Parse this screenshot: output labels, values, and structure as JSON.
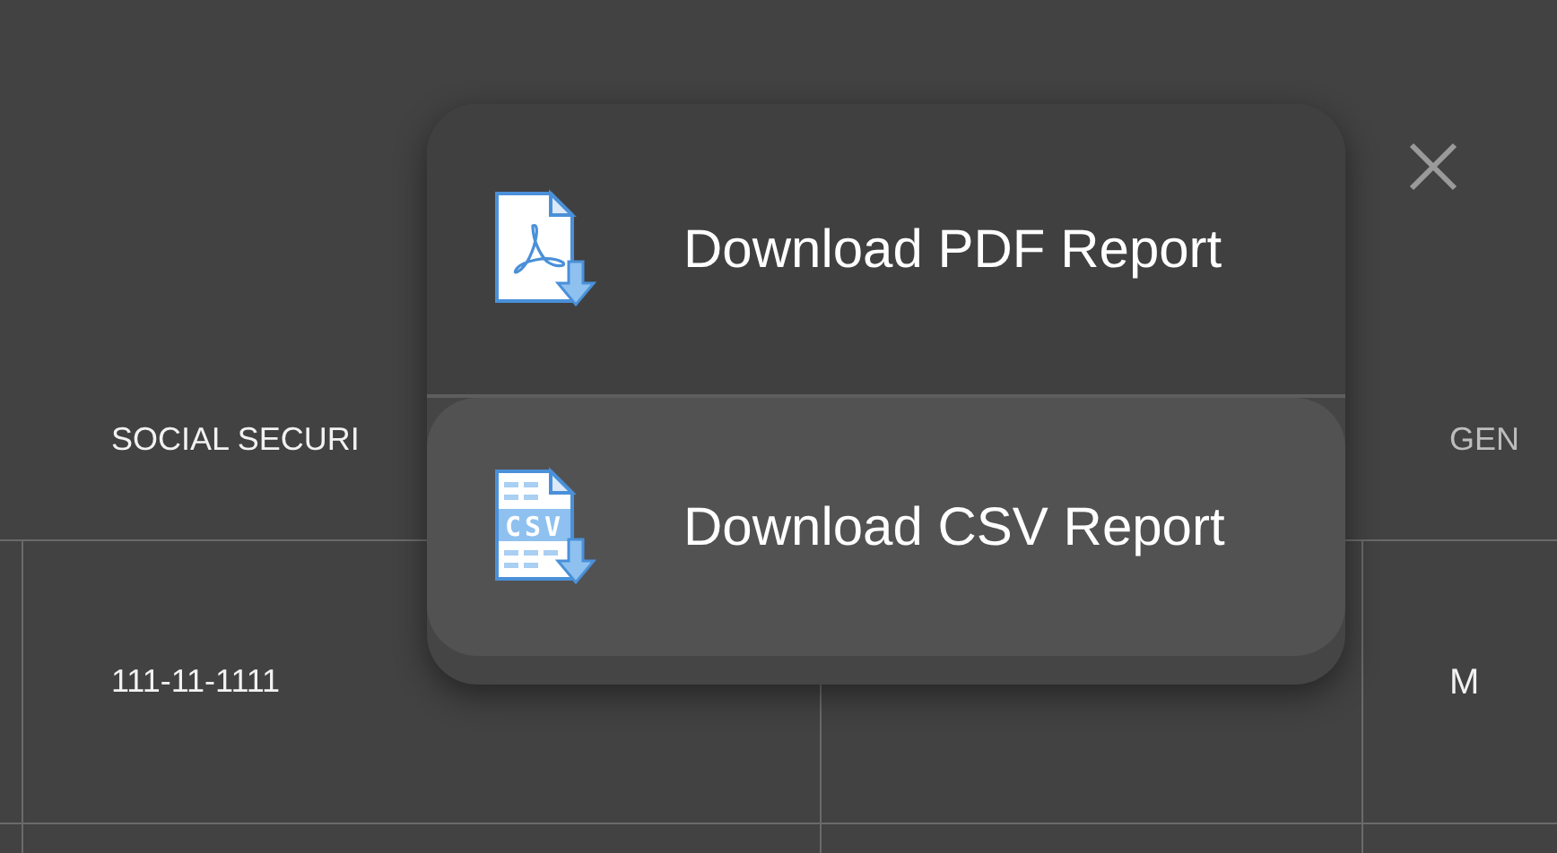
{
  "table": {
    "columns": [
      "SOCIAL SECURI",
      "",
      "GEN"
    ],
    "rows": [
      {
        "cells": [
          "111-11-1111",
          "",
          "M"
        ]
      }
    ]
  },
  "menu": {
    "items": [
      {
        "kind": "pdf",
        "label": "Download PDF Report",
        "selected": false
      },
      {
        "kind": "csv",
        "label": "Download CSV Report",
        "selected": true,
        "icon_label": "CSV"
      }
    ]
  }
}
